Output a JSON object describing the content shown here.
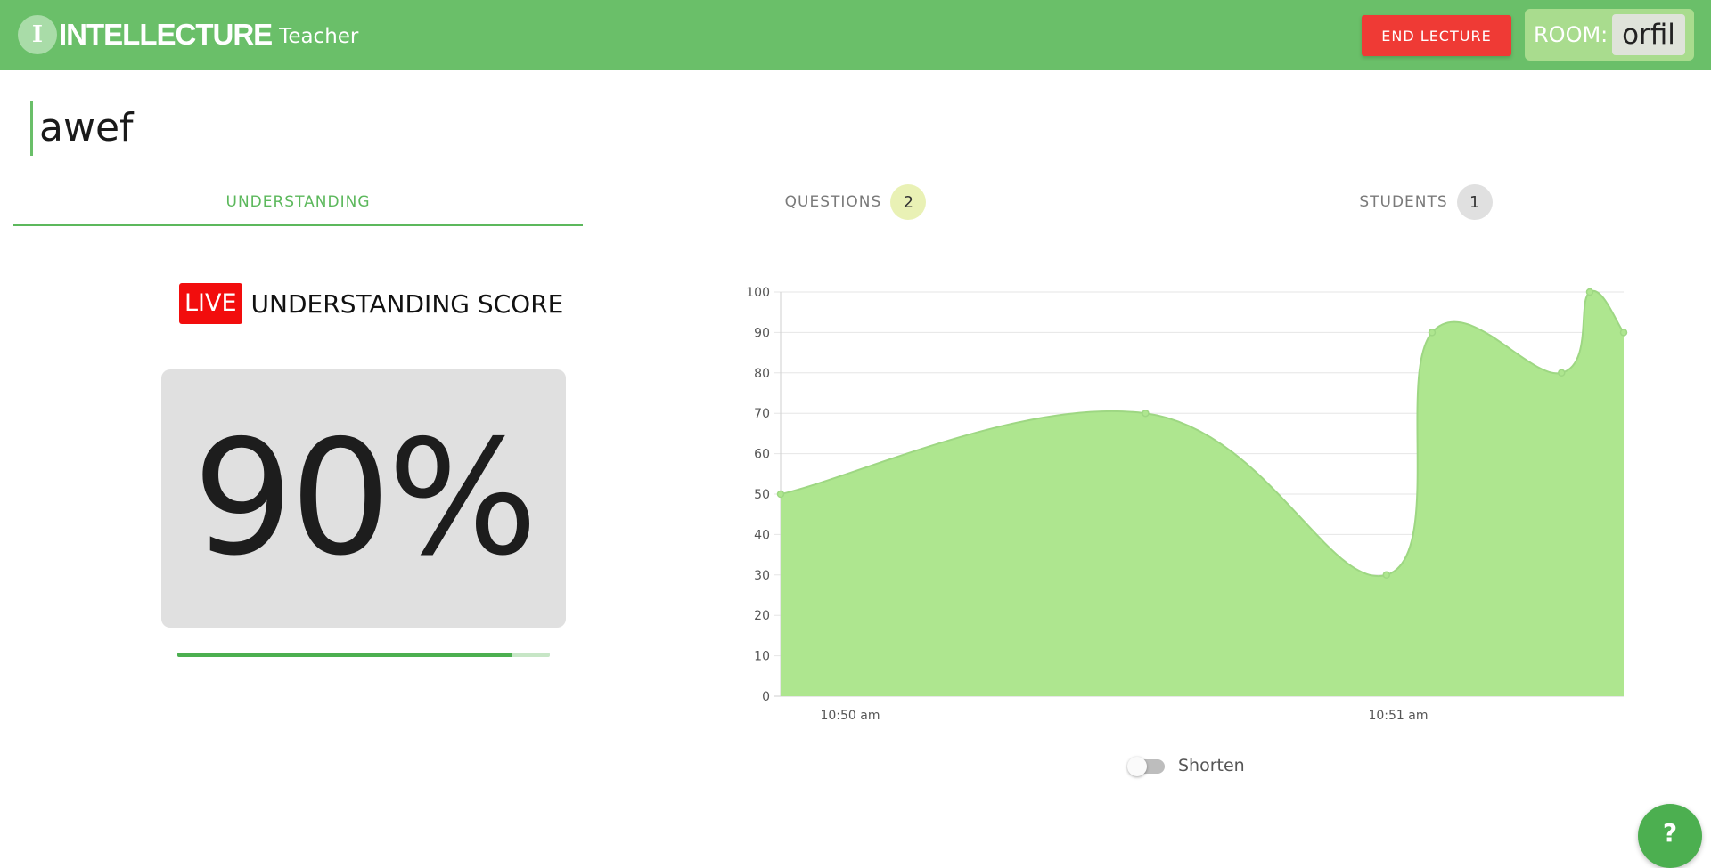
{
  "header": {
    "logo_letter": "I",
    "app_name": "INTELLECTURE",
    "role": "Teacher",
    "end_button": "END LECTURE",
    "room_label": "ROOM:",
    "room_code": "orfil",
    "bar_color": "#6abf69",
    "end_button_color": "#ef3a35"
  },
  "lecture": {
    "title": "awef"
  },
  "tabs": [
    {
      "label": "UNDERSTANDING",
      "active": true
    },
    {
      "label": "QUESTIONS",
      "badge": "2"
    },
    {
      "label": "STUDENTS",
      "badge": "1"
    }
  ],
  "understanding": {
    "live_tag": "LIVE",
    "heading": "UNDERSTANDING SCORE",
    "score": "90%",
    "progress_fraction": 0.9
  },
  "chart_data": {
    "type": "area",
    "title": "",
    "xlabel": "",
    "ylabel": "",
    "ylim": [
      0,
      100
    ],
    "yticks": [
      "0",
      "10",
      "20",
      "30",
      "40",
      "50",
      "60",
      "70",
      "80",
      "90",
      "100"
    ],
    "xtick_labels": [
      "10:50 am",
      "10:51 am"
    ],
    "grid": true,
    "fill_color": "#aee68f",
    "line_color": "#9ed783",
    "series": [
      {
        "values": [
          50,
          70,
          30,
          90,
          80,
          100,
          90
        ]
      }
    ]
  },
  "controls": {
    "shorten_label": "Shorten",
    "shorten_on": false
  },
  "help": {
    "label": "?"
  }
}
